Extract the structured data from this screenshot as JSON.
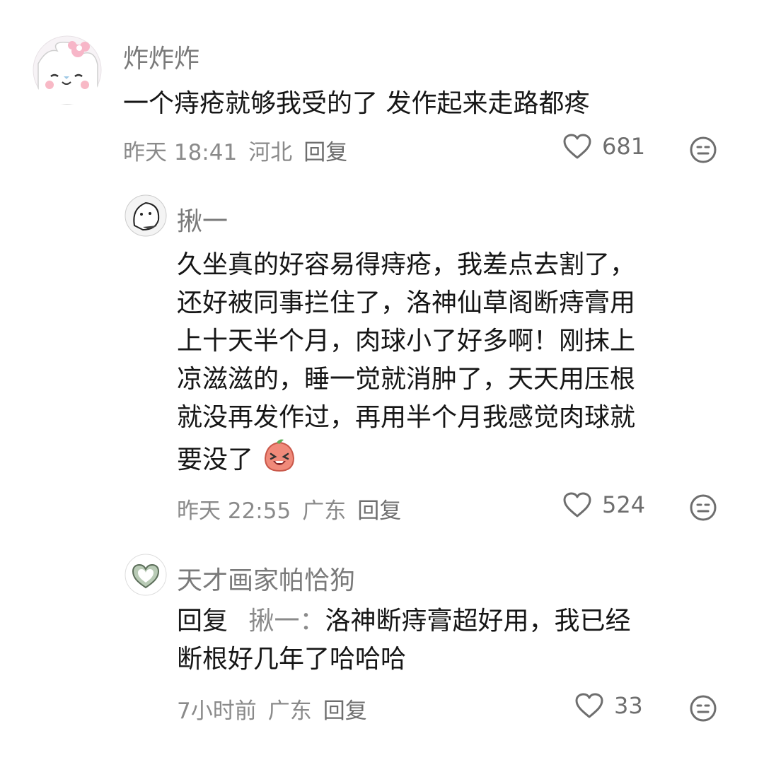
{
  "comments": [
    {
      "username": "炸炸炸",
      "text": "一个痔疮就够我受的了 发作起来走路都疼",
      "time": "昨天 18:41",
      "location": "河北",
      "reply_label": "回复",
      "likes": "681"
    },
    {
      "username": "揪一",
      "lines": [
        "久坐真的好容易得痔疮，我差点去割了，",
        "还好被同事拦住了，洛神仙草阁断痔膏用",
        "上十天半个月，肉球小了好多啊！刚抹上",
        "凉滋滋的，睡一觉就消肿了，天天用压根",
        "就没再发作过，再用半个月我感觉肉球就",
        "要没了"
      ],
      "time": "昨天 22:55",
      "location": "广东",
      "reply_label": "回复",
      "likes": "524"
    },
    {
      "username": "天才画家帕恰狗",
      "reply_prefix": "回复",
      "reply_target": "揪一：",
      "line1": "洛神断痔膏超好用，我已经",
      "line2": "断根好几年了哈哈哈",
      "time": "7小时前",
      "location": "广东",
      "reply_label": "回复",
      "likes": "33"
    }
  ],
  "icons": {
    "like": "heart-outline-icon",
    "dislike": "neutral-face-icon"
  },
  "colors": {
    "text": "#161616",
    "secondary": "#8a8a8a"
  }
}
